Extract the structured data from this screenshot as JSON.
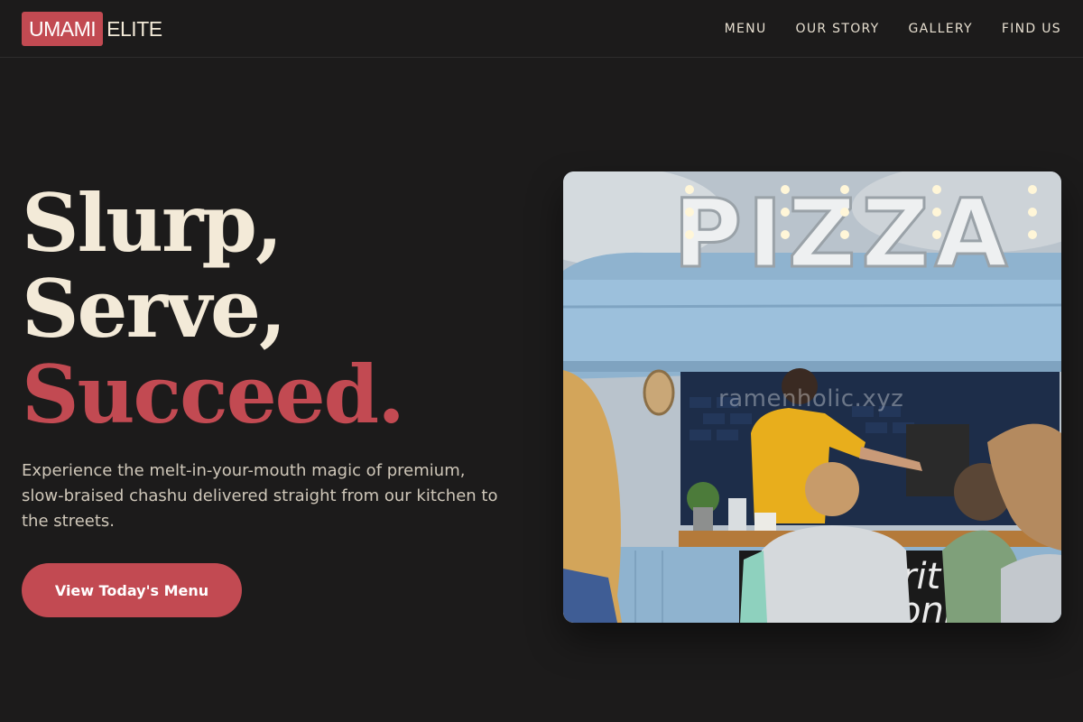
{
  "brand": {
    "logo_highlight": "UMAMI",
    "logo_rest": "ELITE",
    "accent_color": "#c24a52",
    "cream_color": "#f3ead8",
    "background_color": "#1c1b1b"
  },
  "nav": {
    "items": [
      {
        "label": "MENU"
      },
      {
        "label": "OUR STORY"
      },
      {
        "label": "GALLERY"
      },
      {
        "label": "FIND US"
      }
    ]
  },
  "hero": {
    "headline_line1": "Slurp,",
    "headline_line2": "Serve,",
    "headline_line3": "Succeed.",
    "description": "Experience the melt-in-your-mouth magic of premium, slow-braised chashu delivered straight from our kitchen to the streets.",
    "cta_label": "View Today's Menu",
    "image": {
      "sign_text": "PIZZA",
      "board_text_1": "rit",
      "board_text_2": "oni",
      "board_price": "£",
      "watermark": "ramenholic.xyz"
    }
  }
}
